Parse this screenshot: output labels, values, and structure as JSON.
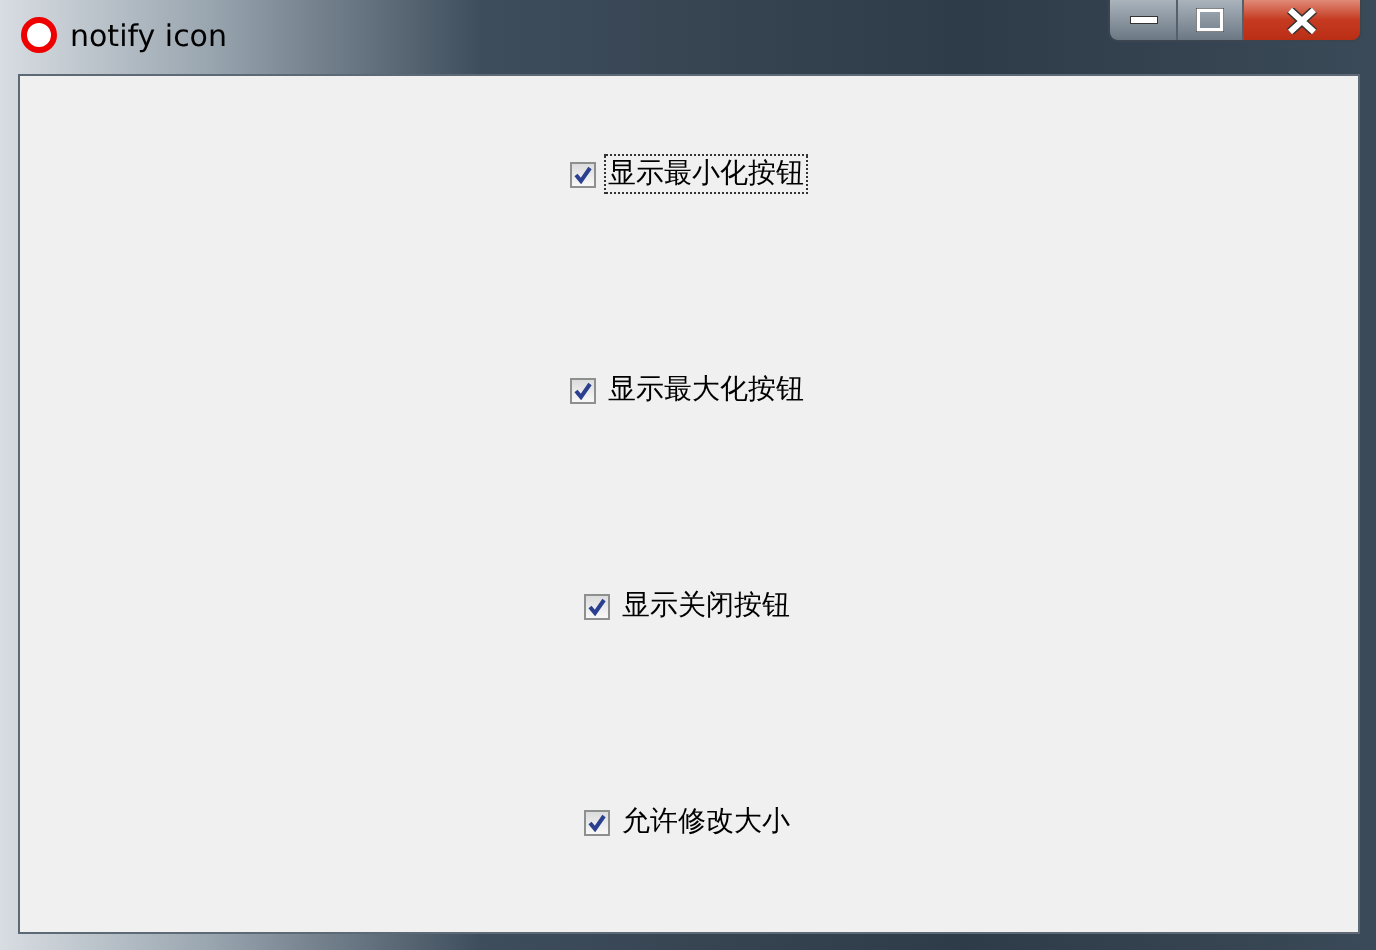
{
  "window": {
    "title": "notify icon"
  },
  "checkboxes": [
    {
      "label": "显示最小化按钮",
      "checked": true,
      "focused": true
    },
    {
      "label": "显示最大化按钮",
      "checked": true,
      "focused": false
    },
    {
      "label": "显示关闭按钮",
      "checked": true,
      "focused": false
    },
    {
      "label": "允许修改大小",
      "checked": true,
      "focused": false
    }
  ]
}
